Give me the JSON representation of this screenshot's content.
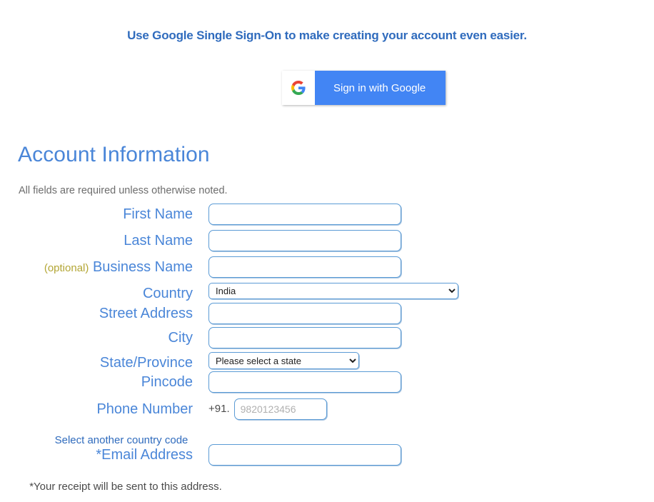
{
  "sso": {
    "heading": "Use Google Single Sign-On to make creating your account even easier.",
    "button_label": "Sign in with Google",
    "icon": "google-g-icon",
    "button_color": "#4285f4"
  },
  "account_section": {
    "title": "Account Information",
    "note": "All fields are required unless otherwise noted.",
    "title_color": "#4a86d8"
  },
  "form": {
    "fields": [
      {
        "label": "First Name",
        "type": "text",
        "value": "",
        "placeholder": "",
        "optional_tag": ""
      },
      {
        "label": "Last Name",
        "type": "text",
        "value": "",
        "placeholder": "",
        "optional_tag": ""
      },
      {
        "label": "Business Name",
        "type": "text",
        "value": "",
        "placeholder": "",
        "optional_tag": "(optional)"
      },
      {
        "label": "Country",
        "type": "select",
        "value": "India",
        "placeholder": "",
        "optional_tag": ""
      },
      {
        "label": "Street Address",
        "type": "text",
        "value": "",
        "placeholder": "",
        "optional_tag": ""
      },
      {
        "label": "City",
        "type": "text",
        "value": "",
        "placeholder": "",
        "optional_tag": ""
      },
      {
        "label": "State/Province",
        "type": "select",
        "value": "Please select a state",
        "placeholder": "",
        "optional_tag": ""
      },
      {
        "label": "Pincode",
        "type": "text",
        "value": "",
        "placeholder": "",
        "optional_tag": ""
      },
      {
        "label": "Phone Number",
        "type": "phone",
        "value": "",
        "placeholder": "9820123456",
        "prefix": "+91.",
        "optional_tag": ""
      },
      {
        "label": "*Email Address",
        "type": "text",
        "value": "",
        "placeholder": "",
        "optional_tag": ""
      }
    ],
    "country_selected": "India",
    "state_selected": "Please select a state",
    "phone_prefix": "+91.",
    "phone_placeholder": "9820123456",
    "country_code_link": "Select another country code",
    "email_note": "*Your receipt will be sent to this address.",
    "optional_color": "#b3a635",
    "label_color": "#4a86d8",
    "input_border_color": "#5b9bd5"
  }
}
